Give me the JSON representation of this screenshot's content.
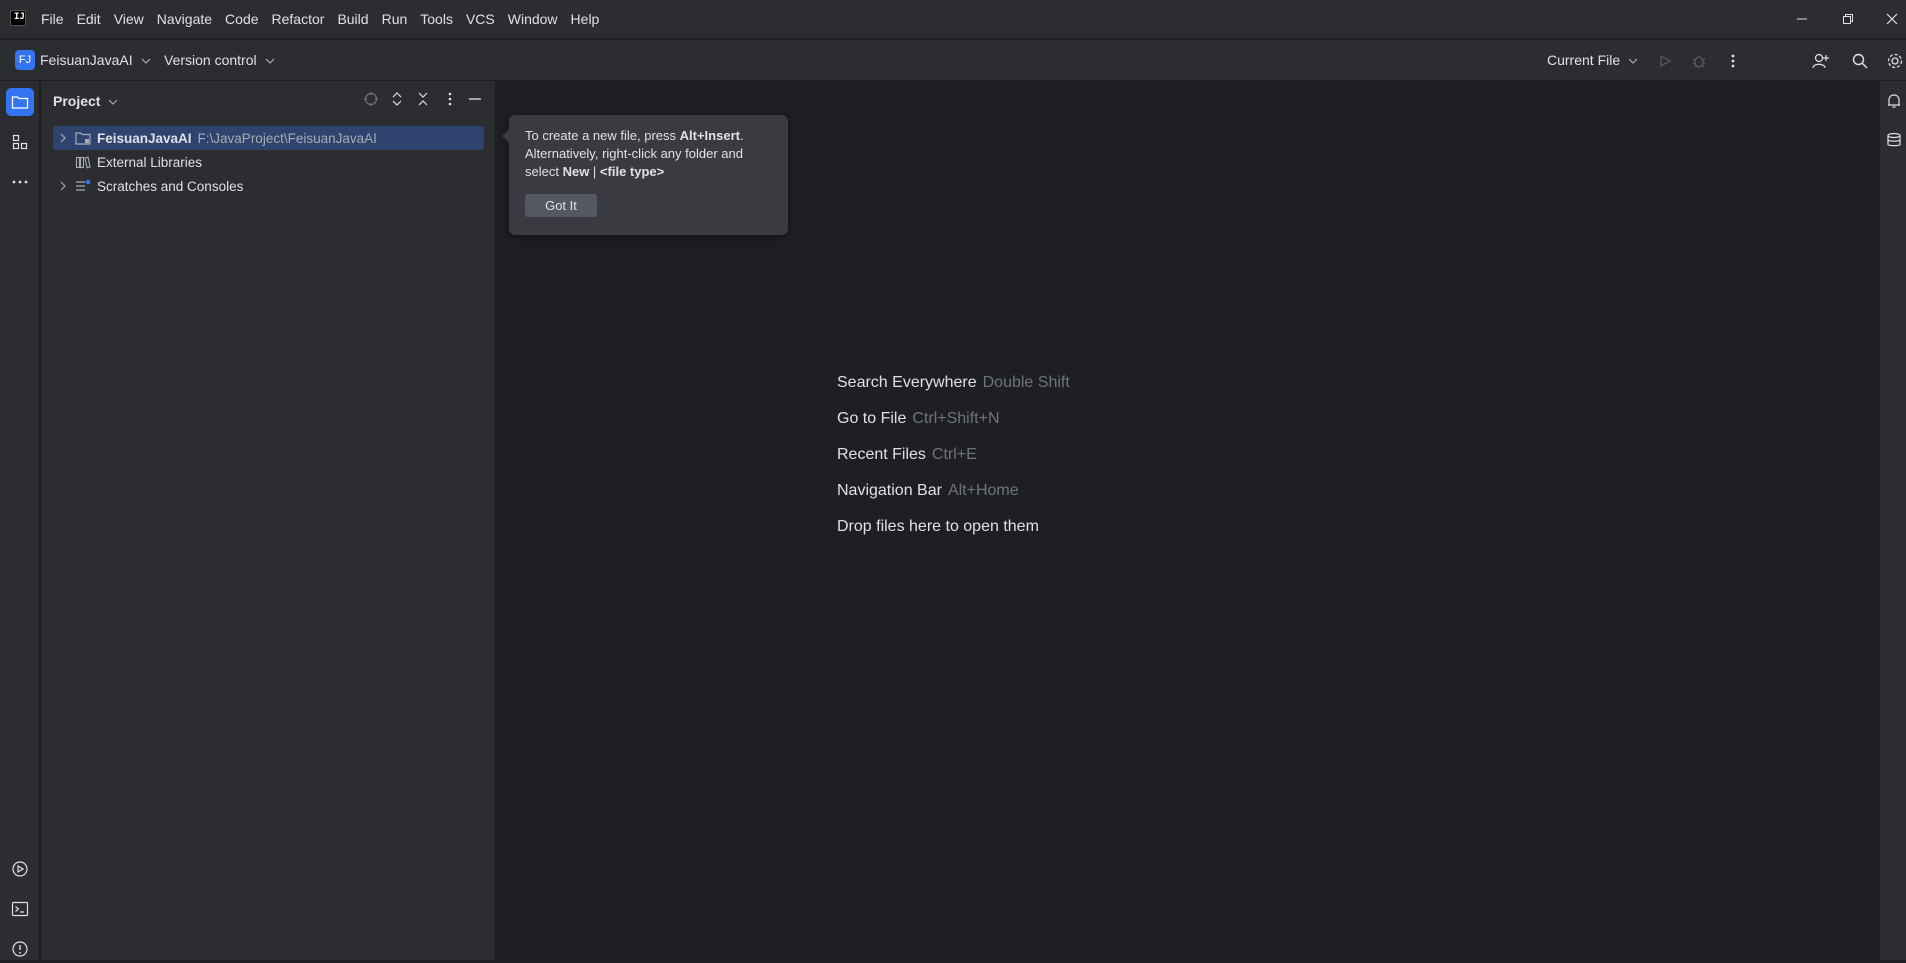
{
  "app": {
    "logo_text": "IJ",
    "menu": [
      "File",
      "Edit",
      "View",
      "Navigate",
      "Code",
      "Refactor",
      "Build",
      "Run",
      "Tools",
      "VCS",
      "Window",
      "Help"
    ]
  },
  "toolbar": {
    "project_initials": "FJ",
    "project_name": "FeisuanJavaAI",
    "version_control": "Version control",
    "run_config": "Current File"
  },
  "project_panel": {
    "title": "Project",
    "tree": [
      {
        "label": "FeisuanJavaAI",
        "path": "F:\\JavaProject\\FeisuanJavaAI",
        "expandable": true,
        "selected": true
      },
      {
        "label": "External Libraries",
        "path": "",
        "expandable": false,
        "selected": false
      },
      {
        "label": "Scratches and Consoles",
        "path": "",
        "expandable": true,
        "selected": false
      }
    ]
  },
  "tooltip": {
    "line1_pre": "To create a new file, press ",
    "line1_key": "Alt+Insert",
    "line1_post": ".",
    "line2": "Alternatively, right-click any folder and",
    "line3_pre": "select ",
    "line3_new": "New",
    "line3_sep": " | ",
    "line3_type": "<file type>",
    "button": "Got It"
  },
  "editor_hints": [
    {
      "action": "Search Everywhere",
      "shortcut": "Double Shift"
    },
    {
      "action": "Go to File",
      "shortcut": "Ctrl+Shift+N"
    },
    {
      "action": "Recent Files",
      "shortcut": "Ctrl+E"
    },
    {
      "action": "Navigation Bar",
      "shortcut": "Alt+Home"
    },
    {
      "action": "Drop files here to open them",
      "shortcut": ""
    }
  ],
  "colors": {
    "accent": "#3574f0",
    "selection": "#2e436e",
    "panel_bg": "#2b2d30",
    "editor_bg": "#1e1f22"
  }
}
